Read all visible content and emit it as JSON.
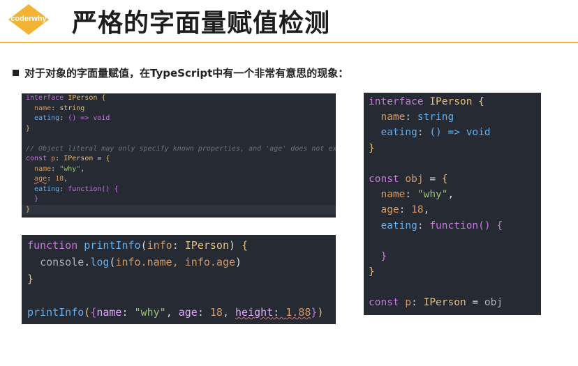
{
  "logo": {
    "text": "coderwhy",
    "color": "#f2b233"
  },
  "title": "严格的字面量赋值检测",
  "bullet": "对于对象的字面量赋值，在TypeScript中有一个非常有意思的现象：",
  "code1": {
    "line1": {
      "kw": "interface",
      "type": "IPerson",
      "brace": "{"
    },
    "line2": {
      "prop": "name",
      "type": "string"
    },
    "line3": {
      "prop": "eating",
      "sig": "() => void"
    },
    "line4": "}",
    "comment": "// Object literal may only specify known properties, and 'age' does not exist",
    "line6": {
      "kw": "const",
      "name": "p",
      "type": "IPerson",
      "brace": "{"
    },
    "line7": {
      "prop": "name",
      "str": "\"why\""
    },
    "line8": {
      "prop": "age",
      "num": "18"
    },
    "line9": {
      "prop": "eating",
      "fn": "function() {"
    },
    "line10": "}",
    "line11": "}"
  },
  "code2": {
    "line1": {
      "kw": "function",
      "fn": "printInfo",
      "param": "info",
      "type": "IPerson"
    },
    "line2": {
      "obj": "console",
      "method": "log",
      "args": "info.name, info.age"
    },
    "line3": "}",
    "line4": {
      "fn": "printInfo",
      "name_key": "name",
      "name_val": "\"why\"",
      "age_key": "age",
      "age_val": "18",
      "height_key": "height",
      "height_val": "1.88"
    }
  },
  "code3": {
    "line1": {
      "kw": "interface",
      "type": "IPerson",
      "brace": "{"
    },
    "line2": {
      "prop": "name",
      "type": "string"
    },
    "line3": {
      "prop": "eating",
      "sig": "() => void"
    },
    "line4": "}",
    "line6": {
      "kw": "const",
      "name": "obj",
      "brace": "{"
    },
    "line7": {
      "prop": "name",
      "str": "\"why\""
    },
    "line8": {
      "prop": "age",
      "num": "18"
    },
    "line9": {
      "prop": "eating",
      "fn": "function() {"
    },
    "line11": "}",
    "line12": "}",
    "line14": {
      "kw": "const",
      "name": "p",
      "type": "IPerson",
      "value": "obj"
    }
  }
}
